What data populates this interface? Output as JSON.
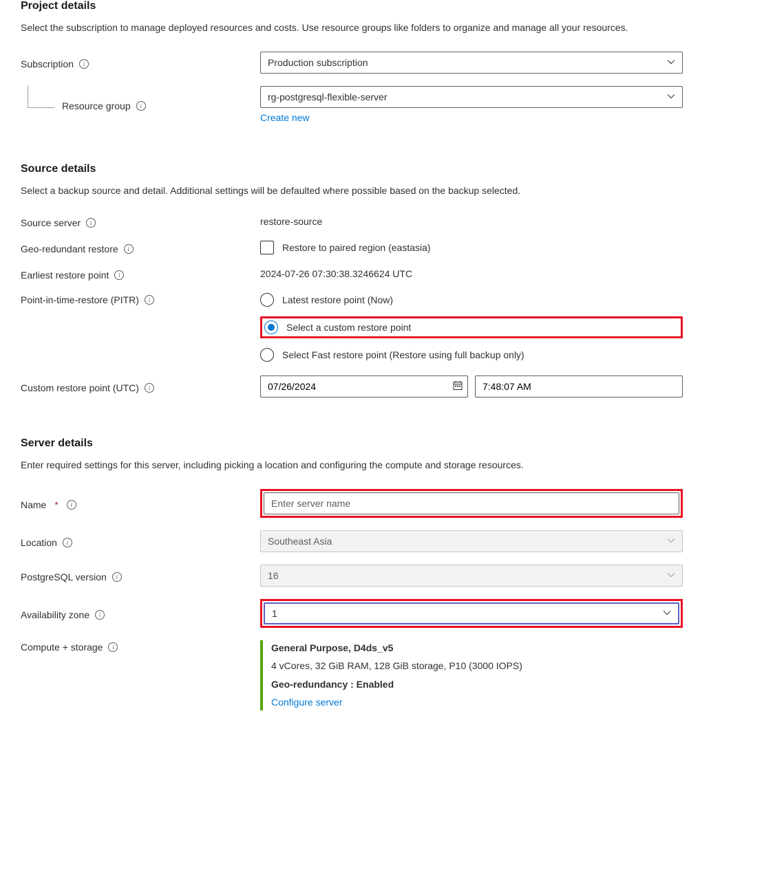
{
  "project": {
    "title": "Project details",
    "desc": "Select the subscription to manage deployed resources and costs. Use resource groups like folders to organize and manage all your resources.",
    "subscription_label": "Subscription",
    "subscription_value": "Production subscription",
    "rg_label": "Resource group",
    "rg_value": "rg-postgresql-flexible-server",
    "create_new": "Create new"
  },
  "source": {
    "title": "Source details",
    "desc": "Select a backup source and detail. Additional settings will be defaulted where possible based on the backup selected.",
    "server_label": "Source server",
    "server_value": "restore-source",
    "geo_label": "Geo-redundant restore",
    "geo_checkbox_label": "Restore to paired region (eastasia)",
    "earliest_label": "Earliest restore point",
    "earliest_value": "2024-07-26 07:30:38.3246624 UTC",
    "pitr_label": "Point-in-time-restore (PITR)",
    "pitr_options": {
      "latest": "Latest restore point (Now)",
      "custom": "Select a custom restore point",
      "fast": "Select Fast restore point (Restore using full backup only)"
    },
    "custom_label": "Custom restore point (UTC)",
    "custom_date": "07/26/2024",
    "custom_time": "7:48:07 AM"
  },
  "server": {
    "title": "Server details",
    "desc": "Enter required settings for this server, including picking a location and configuring the compute and storage resources.",
    "name_label": "Name",
    "name_placeholder": "Enter server name",
    "location_label": "Location",
    "location_value": "Southeast Asia",
    "pg_label": "PostgreSQL version",
    "pg_value": "16",
    "az_label": "Availability zone",
    "az_value": "1",
    "compute_label": "Compute + storage",
    "compute_sku": "General Purpose, D4ds_v5",
    "compute_detail": "4 vCores, 32 GiB RAM, 128 GiB storage, P10 (3000 IOPS)",
    "compute_geo": "Geo-redundancy : Enabled",
    "configure_link": "Configure server"
  }
}
